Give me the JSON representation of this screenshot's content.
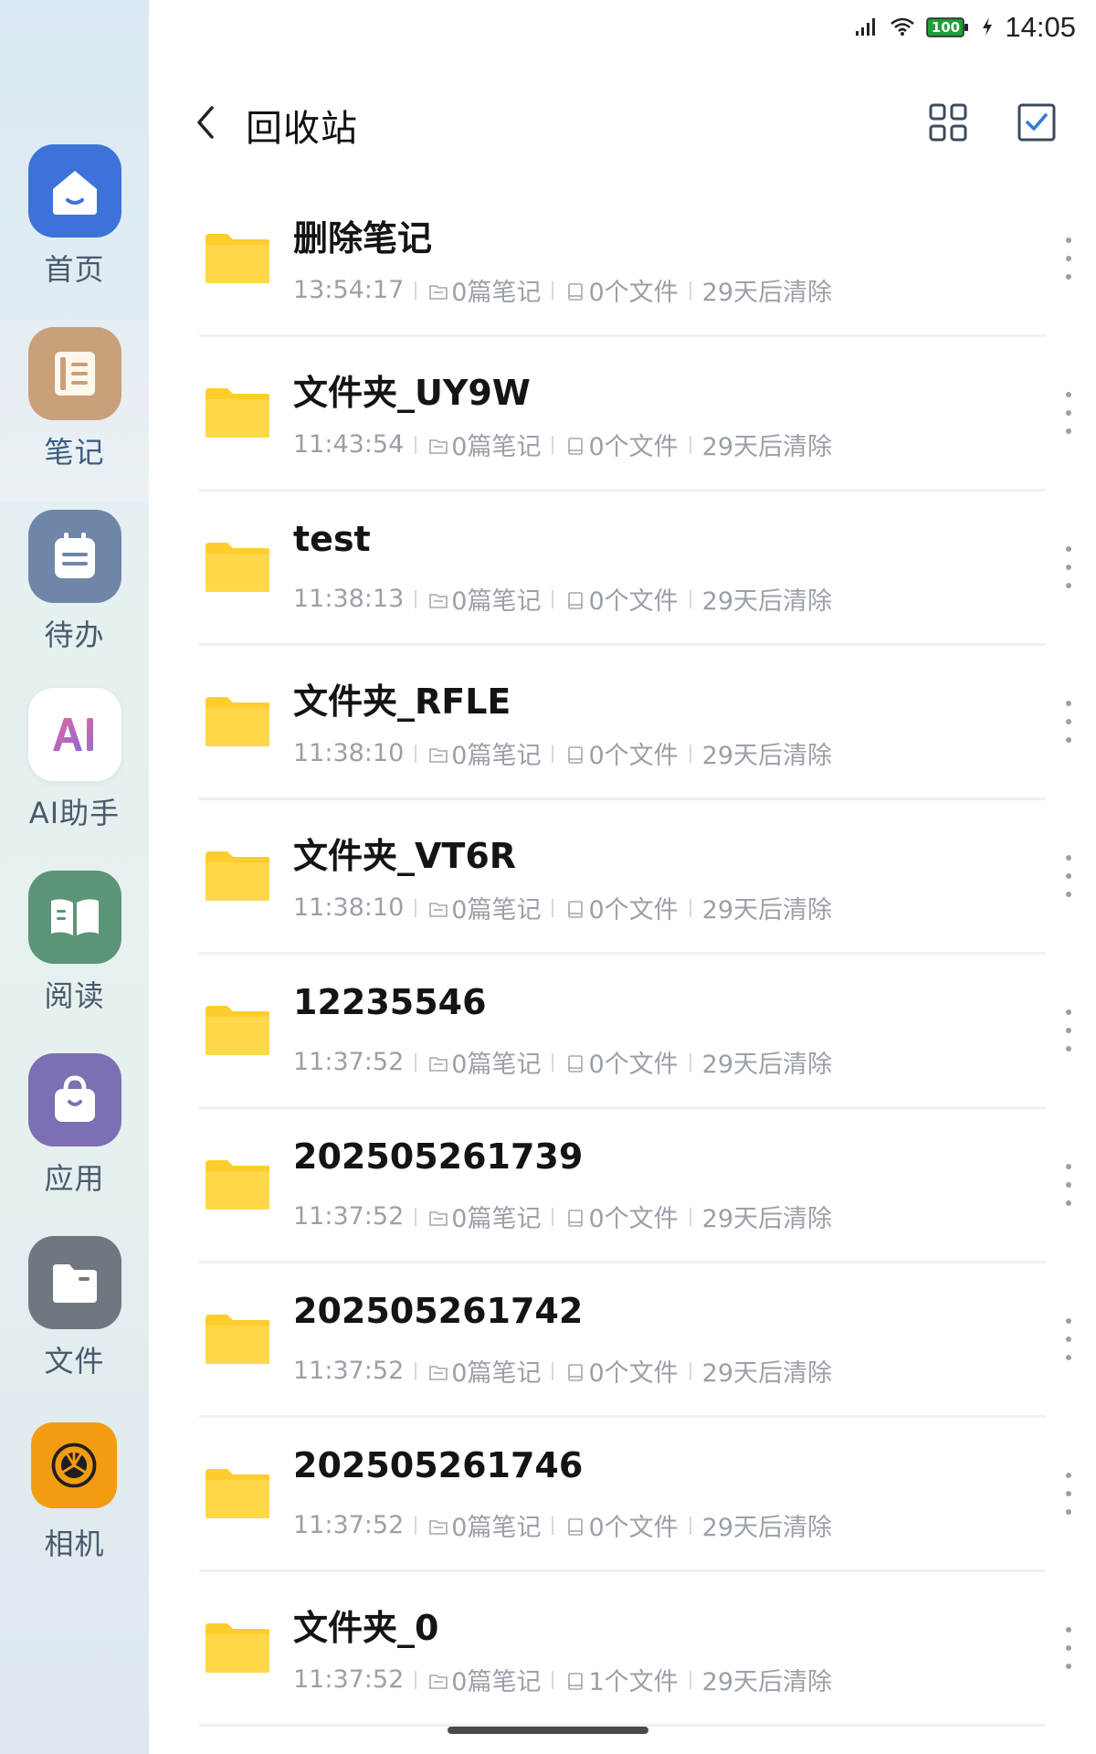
{
  "status_bar": {
    "time": "14:05",
    "battery": "100"
  },
  "sidebar": {
    "items": [
      {
        "label": "首页",
        "icon": "home-icon",
        "color": "#3d73d9"
      },
      {
        "label": "笔记",
        "icon": "notebook-icon",
        "color": "#c9a07a"
      },
      {
        "label": "待办",
        "icon": "todo-icon",
        "color": "#6f86a8"
      },
      {
        "label": "AI助手",
        "icon": "ai-icon",
        "color": "#ffffff"
      },
      {
        "label": "阅读",
        "icon": "reading-icon",
        "color": "#5c9478"
      },
      {
        "label": "应用",
        "icon": "apps-icon",
        "color": "#7c6fb3"
      },
      {
        "label": "文件",
        "icon": "files-icon",
        "color": "#6f7780"
      },
      {
        "label": "相机",
        "icon": "camera-icon",
        "color": "#f39c12"
      }
    ]
  },
  "header": {
    "title": "回收站"
  },
  "items": [
    {
      "name": "删除笔记",
      "time": "13:54:17",
      "notes": "0篇笔记",
      "files": "0个文件",
      "expiry": "29天后清除"
    },
    {
      "name": "文件夹_UY9W",
      "time": "11:43:54",
      "notes": "0篇笔记",
      "files": "0个文件",
      "expiry": "29天后清除"
    },
    {
      "name": "test",
      "time": "11:38:13",
      "notes": "0篇笔记",
      "files": "0个文件",
      "expiry": "29天后清除"
    },
    {
      "name": "文件夹_RFLE",
      "time": "11:38:10",
      "notes": "0篇笔记",
      "files": "0个文件",
      "expiry": "29天后清除"
    },
    {
      "name": "文件夹_VT6R",
      "time": "11:38:10",
      "notes": "0篇笔记",
      "files": "0个文件",
      "expiry": "29天后清除"
    },
    {
      "name": "12235546",
      "time": "11:37:52",
      "notes": "0篇笔记",
      "files": "0个文件",
      "expiry": "29天后清除"
    },
    {
      "name": "202505261739",
      "time": "11:37:52",
      "notes": "0篇笔记",
      "files": "0个文件",
      "expiry": "29天后清除"
    },
    {
      "name": "202505261742",
      "time": "11:37:52",
      "notes": "0篇笔记",
      "files": "0个文件",
      "expiry": "29天后清除"
    },
    {
      "name": "202505261746",
      "time": "11:37:52",
      "notes": "0篇笔记",
      "files": "0个文件",
      "expiry": "29天后清除"
    },
    {
      "name": "文件夹_0",
      "time": "11:37:52",
      "notes": "0篇笔记",
      "files": "1个文件",
      "expiry": "29天后清除"
    }
  ],
  "colors": {
    "folder": "#ffcd2e",
    "accent": "#3d73d9"
  }
}
